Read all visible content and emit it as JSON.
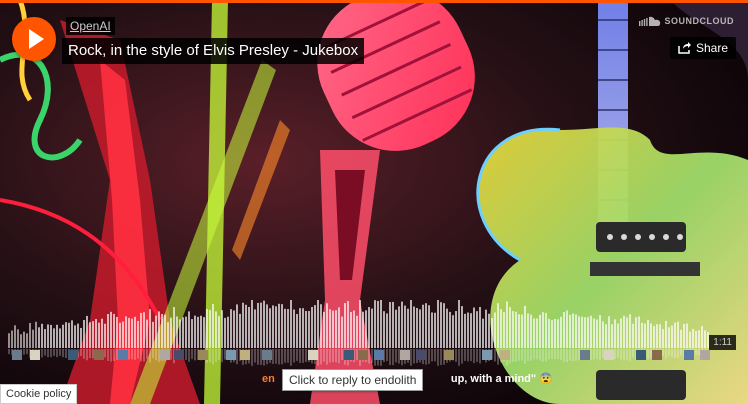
{
  "player": {
    "artist": "OpenAI",
    "title": "Rock, in the style of Elvis Presley - Jukebox",
    "share_label": "Share",
    "logo_text": "SOUNDCLOUD",
    "duration": "1:11",
    "accent_color": "#ff5500"
  },
  "comment": {
    "user": "en",
    "text": "up, with a mind\" 😨"
  },
  "tooltip": "Click to reply to endolith",
  "cookie_policy": "Cookie policy",
  "icons": [
    "play-icon",
    "share-icon",
    "soundcloud-logo-icon"
  ]
}
